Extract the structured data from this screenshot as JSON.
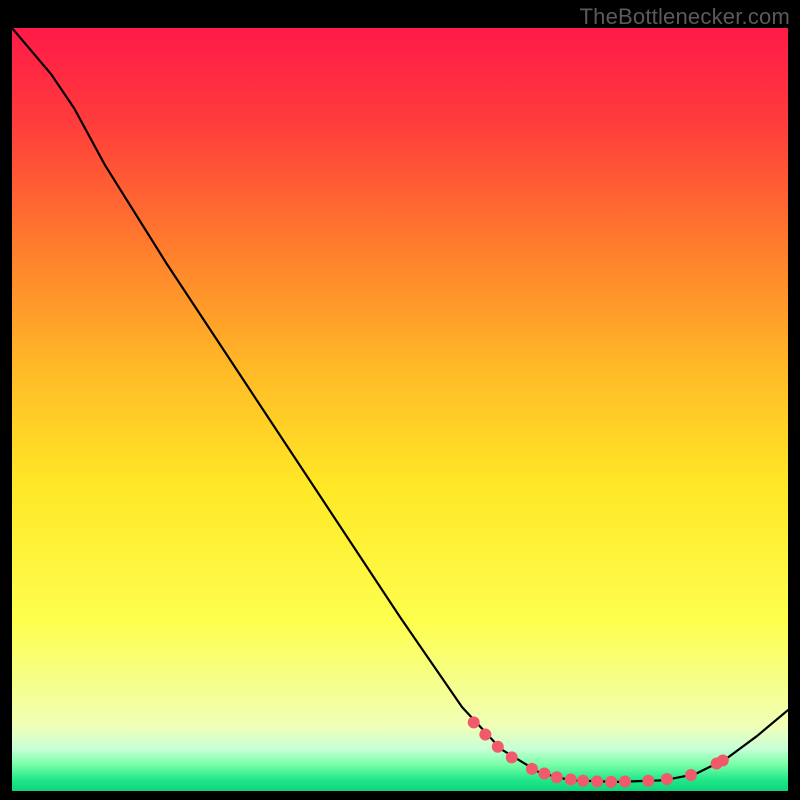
{
  "watermark": "TheBottlenecker.com",
  "chart_data": {
    "type": "line",
    "title": "",
    "xlabel": "",
    "ylabel": "",
    "xlim": [
      0,
      100
    ],
    "ylim": [
      0,
      100
    ],
    "background_gradient": {
      "stops": [
        {
          "offset": 0.0,
          "color": "#ff1a49"
        },
        {
          "offset": 0.12,
          "color": "#ff3b3c"
        },
        {
          "offset": 0.28,
          "color": "#ff7a2d"
        },
        {
          "offset": 0.45,
          "color": "#ffbb27"
        },
        {
          "offset": 0.6,
          "color": "#ffe826"
        },
        {
          "offset": 0.78,
          "color": "#fdff4f"
        },
        {
          "offset": 0.915,
          "color": "#f0ffb7"
        },
        {
          "offset": 0.945,
          "color": "#c7ffd6"
        },
        {
          "offset": 0.965,
          "color": "#7affa8"
        },
        {
          "offset": 0.985,
          "color": "#22e88a"
        },
        {
          "offset": 1.0,
          "color": "#0dd47b"
        }
      ]
    },
    "curve": {
      "description": "single black curve; steep descent left, flat valley ~x70-90, slight rise at far right",
      "points": [
        {
          "x": 0.0,
          "y": 100.0
        },
        {
          "x": 5.0,
          "y": 94.0
        },
        {
          "x": 8.0,
          "y": 89.5
        },
        {
          "x": 12.0,
          "y": 82.0
        },
        {
          "x": 20.0,
          "y": 69.0
        },
        {
          "x": 30.0,
          "y": 53.6
        },
        {
          "x": 40.0,
          "y": 38.2
        },
        {
          "x": 50.0,
          "y": 22.8
        },
        {
          "x": 58.0,
          "y": 11.0
        },
        {
          "x": 63.0,
          "y": 5.5
        },
        {
          "x": 68.0,
          "y": 2.4
        },
        {
          "x": 72.0,
          "y": 1.4
        },
        {
          "x": 78.0,
          "y": 1.2
        },
        {
          "x": 84.0,
          "y": 1.4
        },
        {
          "x": 88.0,
          "y": 2.2
        },
        {
          "x": 92.0,
          "y": 4.2
        },
        {
          "x": 96.0,
          "y": 7.2
        },
        {
          "x": 100.0,
          "y": 10.6
        }
      ]
    },
    "markers": {
      "color": "#f15a6b",
      "radius_px": 6,
      "points": [
        {
          "x": 59.5,
          "y": 9.0
        },
        {
          "x": 61.0,
          "y": 7.4
        },
        {
          "x": 62.6,
          "y": 5.8
        },
        {
          "x": 64.4,
          "y": 4.4
        },
        {
          "x": 67.0,
          "y": 2.9
        },
        {
          "x": 68.6,
          "y": 2.3
        },
        {
          "x": 70.2,
          "y": 1.8
        },
        {
          "x": 72.0,
          "y": 1.5
        },
        {
          "x": 73.6,
          "y": 1.35
        },
        {
          "x": 75.4,
          "y": 1.25
        },
        {
          "x": 77.2,
          "y": 1.2
        },
        {
          "x": 79.0,
          "y": 1.25
        },
        {
          "x": 82.0,
          "y": 1.35
        },
        {
          "x": 84.4,
          "y": 1.55
        },
        {
          "x": 87.5,
          "y": 2.1
        },
        {
          "x": 90.8,
          "y": 3.6
        },
        {
          "x": 91.6,
          "y": 4.0
        }
      ]
    }
  }
}
